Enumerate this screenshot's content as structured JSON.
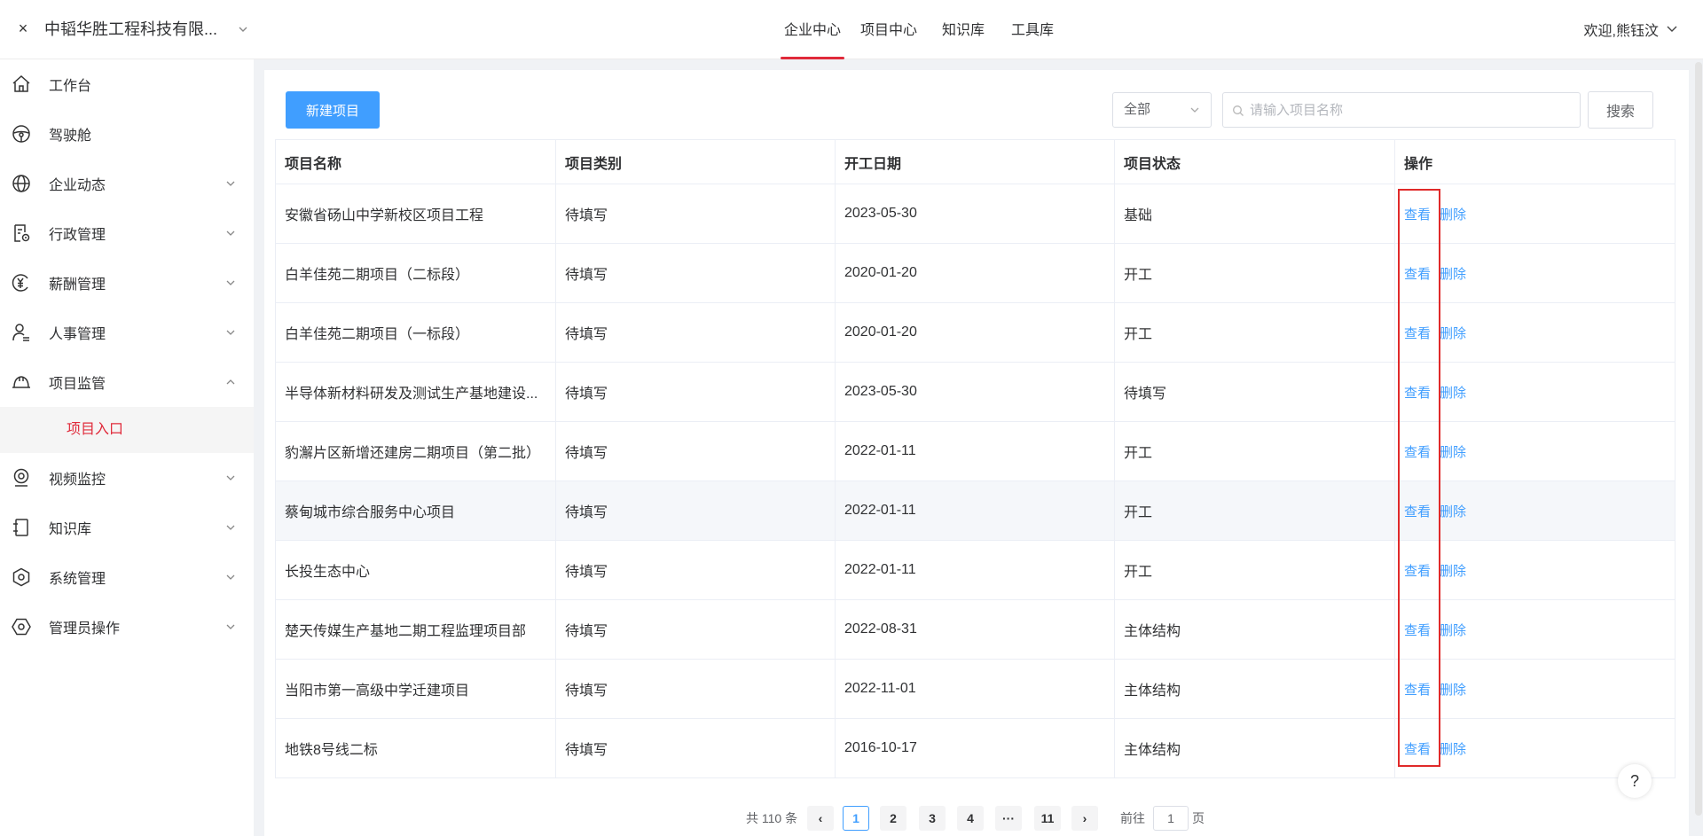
{
  "header": {
    "close_glyph": "×",
    "company_name": "中韬华胜工程科技有限...",
    "nav": [
      {
        "label": "企业中心",
        "active": true
      },
      {
        "label": "项目中心",
        "active": false
      },
      {
        "label": "知识库",
        "active": false
      },
      {
        "label": "工具库",
        "active": false
      }
    ],
    "welcome": "欢迎,熊钰汶"
  },
  "sidebar": {
    "items": [
      {
        "label": "工作台",
        "icon": "home-icon",
        "has_arrow": false
      },
      {
        "label": "驾驶舱",
        "icon": "steering-wheel-icon",
        "has_arrow": false
      },
      {
        "label": "企业动态",
        "icon": "globe-icon",
        "has_arrow": true,
        "expanded": false
      },
      {
        "label": "行政管理",
        "icon": "document-settings-icon",
        "has_arrow": true,
        "expanded": false
      },
      {
        "label": "薪酬管理",
        "icon": "yuan-coin-icon",
        "has_arrow": true,
        "expanded": false
      },
      {
        "label": "人事管理",
        "icon": "user-settings-icon",
        "has_arrow": true,
        "expanded": false
      },
      {
        "label": "项目监管",
        "icon": "hard-hat-icon",
        "has_arrow": true,
        "expanded": true,
        "children": [
          {
            "label": "项目入口",
            "active": true
          }
        ]
      },
      {
        "label": "视频监控",
        "icon": "webcam-icon",
        "has_arrow": true,
        "expanded": false
      },
      {
        "label": "知识库",
        "icon": "notebook-icon",
        "has_arrow": true,
        "expanded": false
      },
      {
        "label": "系统管理",
        "icon": "hexagon-settings-icon",
        "has_arrow": true,
        "expanded": false
      },
      {
        "label": "管理员操作",
        "icon": "hexagon-admin-icon",
        "has_arrow": true,
        "expanded": false
      }
    ]
  },
  "toolbar": {
    "new_project_label": "新建项目",
    "filter_value": "全部",
    "search_placeholder": "请输入项目名称",
    "search_button_label": "搜索"
  },
  "table": {
    "columns": [
      "项目名称",
      "项目类别",
      "开工日期",
      "项目状态",
      "操作"
    ],
    "view_label": "查看",
    "delete_label": "删除",
    "rows": [
      {
        "name": "安徽省砀山中学新校区项目工程",
        "category": "待填写",
        "start_date": "2023-05-30",
        "status": "基础"
      },
      {
        "name": "白羊佳苑二期项目（二标段）",
        "category": "待填写",
        "start_date": "2020-01-20",
        "status": "开工"
      },
      {
        "name": "白羊佳苑二期项目（一标段）",
        "category": "待填写",
        "start_date": "2020-01-20",
        "status": "开工"
      },
      {
        "name": "半导体新材料研发及测试生产基地建设...",
        "category": "待填写",
        "start_date": "2023-05-30",
        "status": "待填写"
      },
      {
        "name": "豹澥片区新增还建房二期项目（第二批）",
        "category": "待填写",
        "start_date": "2022-01-11",
        "status": "开工"
      },
      {
        "name": "蔡甸城市综合服务中心项目",
        "category": "待填写",
        "start_date": "2022-01-11",
        "status": "开工",
        "hover": true
      },
      {
        "name": "长投生态中心",
        "category": "待填写",
        "start_date": "2022-01-11",
        "status": "开工"
      },
      {
        "name": "楚天传媒生产基地二期工程监理项目部",
        "category": "待填写",
        "start_date": "2022-08-31",
        "status": "主体结构"
      },
      {
        "name": "当阳市第一高级中学迁建项目",
        "category": "待填写",
        "start_date": "2022-11-01",
        "status": "主体结构"
      },
      {
        "name": "地铁8号线二标",
        "category": "待填写",
        "start_date": "2016-10-17",
        "status": "主体结构"
      }
    ]
  },
  "pagination": {
    "total_text": "共 110 条",
    "prev_glyph": "‹",
    "next_glyph": "›",
    "pages": [
      "1",
      "2",
      "3",
      "4",
      "···",
      "11"
    ],
    "current_page": "1",
    "jump_prefix": "前往",
    "jump_value": "1",
    "jump_suffix": "页"
  },
  "help_glyph": "?",
  "colors": {
    "accent_red": "#e02a3a",
    "primary_blue": "#409eff",
    "highlight_border": "#e02a2a"
  }
}
